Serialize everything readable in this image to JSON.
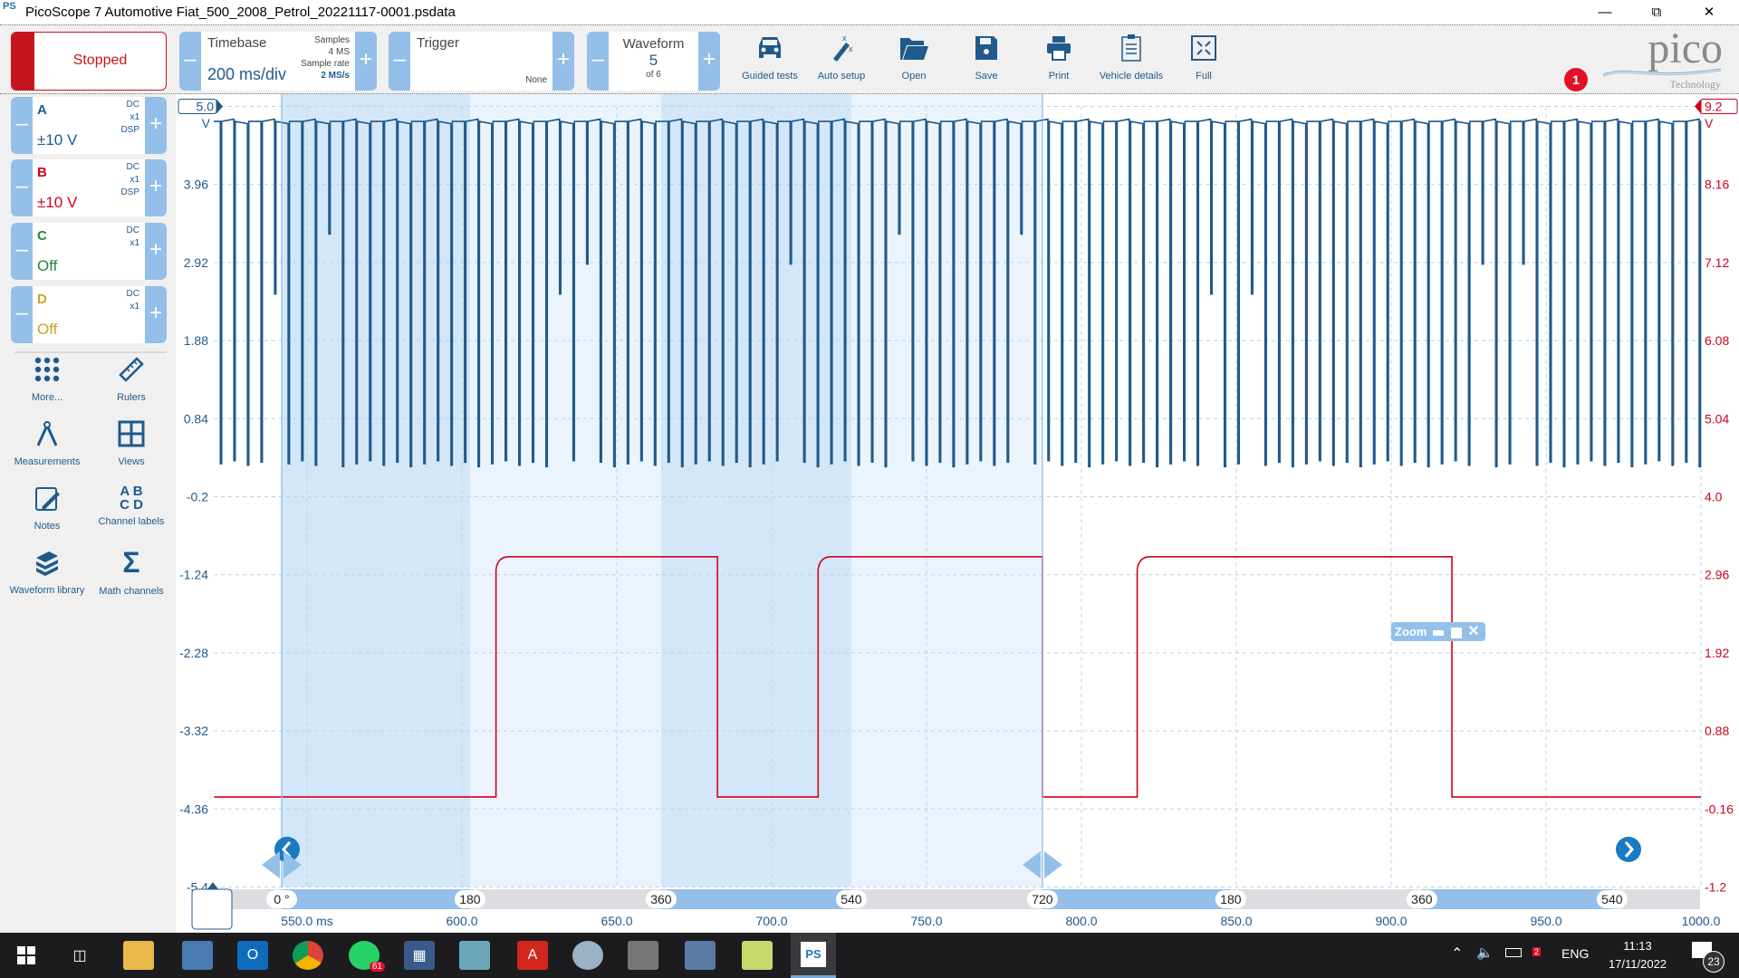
{
  "window": {
    "title": "PicoScope 7 Automotive Fiat_500_2008_Petrol_20221117-0001.psdata",
    "app_icon": "PS",
    "controls": [
      "minimize",
      "restore",
      "close"
    ]
  },
  "toolbar": {
    "run_state": "Stopped",
    "timebase": {
      "label": "Timebase",
      "value": "200 ms/div",
      "samples_label": "Samples",
      "samples": "4 MS",
      "rate_label": "Sample rate",
      "rate": "2 MS/s"
    },
    "trigger": {
      "label": "Trigger",
      "mode": "None"
    },
    "waveform": {
      "label": "Waveform",
      "current": "5",
      "total": "of 6"
    },
    "tools": [
      {
        "label": "Guided tests",
        "icon": "car-icon"
      },
      {
        "label": "Auto setup",
        "icon": "wand-icon"
      },
      {
        "label": "Open",
        "icon": "folder-icon"
      },
      {
        "label": "Save",
        "icon": "save-icon"
      },
      {
        "label": "Print",
        "icon": "printer-icon"
      },
      {
        "label": "Vehicle details",
        "icon": "clipboard-icon"
      },
      {
        "label": "Full",
        "icon": "fullscreen-icon"
      }
    ],
    "notification_count": "1",
    "logo": "pico Technology"
  },
  "channels": [
    {
      "name": "A",
      "range": "±10 V",
      "coupling": "DC",
      "probe": "x1",
      "dsp": "DSP",
      "color": "#1f5a8c"
    },
    {
      "name": "B",
      "range": "±10 V",
      "coupling": "DC",
      "probe": "x1",
      "dsp": "DSP",
      "color": "#d0021b"
    },
    {
      "name": "C",
      "range": "Off",
      "coupling": "DC",
      "probe": "x1",
      "dsp": "",
      "color": "#1e8a3a"
    },
    {
      "name": "D",
      "range": "Off",
      "coupling": "DC",
      "probe": "x1",
      "dsp": "",
      "color": "#c9a227"
    }
  ],
  "side_tools": [
    {
      "label": "More...",
      "icon": "grid-dots-icon"
    },
    {
      "label": "Rulers",
      "icon": "ruler-icon"
    },
    {
      "label": "Measurements",
      "icon": "compass-icon"
    },
    {
      "label": "Views",
      "icon": "views-icon"
    },
    {
      "label": "Notes",
      "icon": "notes-icon"
    },
    {
      "label": "Channel labels",
      "icon": "channel-labels-icon"
    },
    {
      "label": "Waveform library",
      "icon": "library-icon"
    },
    {
      "label": "Math channels",
      "icon": "sigma-icon"
    }
  ],
  "zoom_widget": {
    "label": "Zoom"
  },
  "chart_data": {
    "type": "line",
    "xlabel": "ms",
    "xlim": [
      520,
      1000
    ],
    "x_ticks": [
      "550.0 ms",
      "600.0",
      "650.0",
      "700.0",
      "750.0",
      "800.0",
      "850.0",
      "900.0",
      "950.0",
      "1000.0"
    ],
    "x_tick_values": [
      550,
      600,
      650,
      700,
      750,
      800,
      850,
      900,
      950,
      1000
    ],
    "left_axis": {
      "unit": "V",
      "ylim": [
        -5.4,
        5.0
      ],
      "ticks": [
        "5.0",
        "3.96",
        "2.92",
        "1.88",
        "0.84",
        "-0.2",
        "-1.24",
        "-2.28",
        "-3.32",
        "-4.36",
        "-5.4"
      ],
      "color": "#1f5a8c"
    },
    "right_axis": {
      "unit": "V",
      "ylim": [
        -1.2,
        9.2
      ],
      "ticks": [
        "9.2",
        "8.16",
        "7.12",
        "6.08",
        "5.04",
        "4.0",
        "2.96",
        "1.92",
        "0.88",
        "-0.16",
        "-1.2"
      ],
      "color": "#d0021b"
    },
    "grid": true,
    "series": [
      {
        "name": "A",
        "axis": "left",
        "color": "#1f5a8c",
        "kind": "pulse-train",
        "high_v": 4.8,
        "low_v": 0.2,
        "spike_period_ms": 4.38
      },
      {
        "name": "B",
        "axis": "right",
        "color": "#d0021b",
        "kind": "square",
        "low_v": 0.0,
        "high_v": 3.2,
        "transitions": [
          {
            "t": 520,
            "v": 0.0
          },
          {
            "t": 611,
            "v": 3.2
          },
          {
            "t": 682.5,
            "v": 0.0
          },
          {
            "t": 715,
            "v": 3.2
          },
          {
            "t": 787.4,
            "v": 0.0
          },
          {
            "t": 818,
            "v": 3.2
          },
          {
            "t": 919.6,
            "v": 0.0
          },
          {
            "t": 1000,
            "v": 0.0
          }
        ]
      }
    ],
    "rotation_ruler": {
      "cursors_ms": [
        541.8,
        787.4
      ],
      "labels": [
        "0 °",
        "180",
        "360",
        "540",
        "720",
        "180",
        "360",
        "540"
      ],
      "label_ms": [
        541.8,
        602.6,
        664.3,
        725.7,
        787.4,
        848.2,
        909.9,
        971.3
      ]
    }
  },
  "taskbar": {
    "apps": [
      "start",
      "task-view",
      "file-explorer",
      "app",
      "outlook",
      "chrome",
      "whatsapp",
      "calculator",
      "app",
      "acrobat",
      "paint",
      "app",
      "app",
      "app",
      "picoscope"
    ],
    "whatsapp_badge": "61",
    "tray": {
      "language": "ENG",
      "time": "11:13",
      "date": "17/11/2022",
      "notifications": "23",
      "badge": "2"
    }
  }
}
